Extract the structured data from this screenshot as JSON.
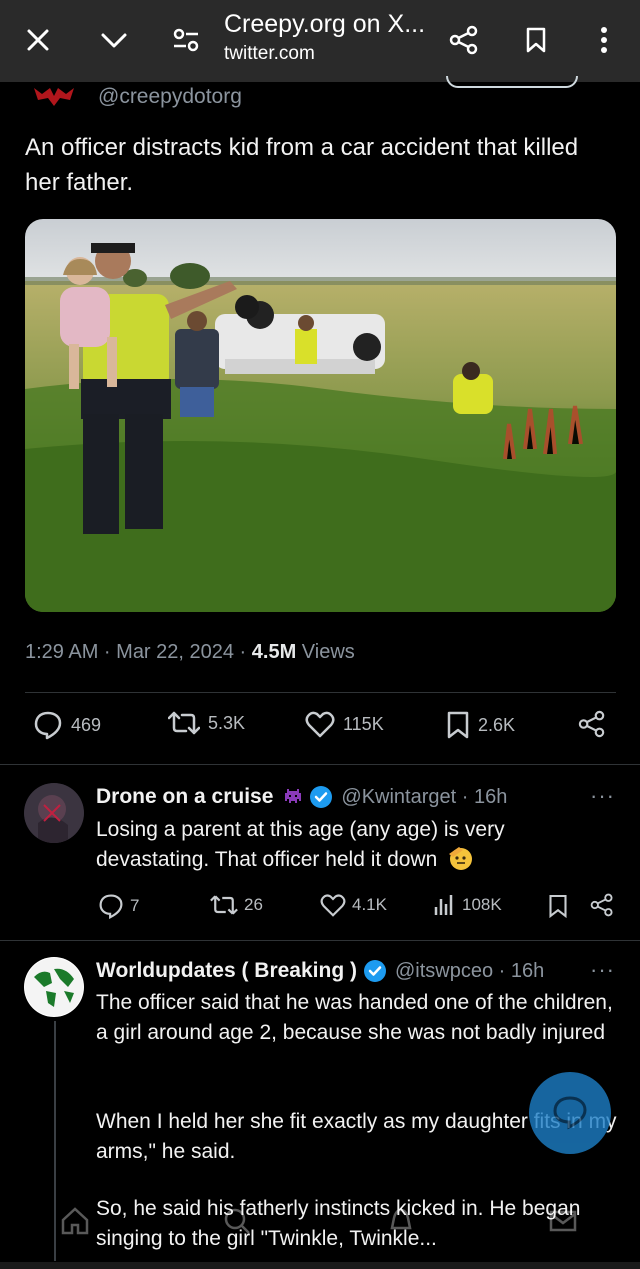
{
  "browser": {
    "title": "Creepy.org on X...",
    "url": "twitter.com"
  },
  "tweet": {
    "handle": "@creepydotorg",
    "text": "An officer distracts kid from a car accident that killed her father.",
    "time_date": "1:29 AM · Mar 22, 2024 · ",
    "views_count": "4.5M",
    "views_label": " Views",
    "replies": "469",
    "retweets": "5.3K",
    "likes": "115K",
    "bookmarks": "2.6K"
  },
  "replies": [
    {
      "name": "Drone on a cruise",
      "handle_time": "@Kwintarget · 16h",
      "text": "Losing a parent at this age (any age) is very devastating. That officer held it down",
      "replies": "7",
      "retweets": "26",
      "likes": "4.1K",
      "views": "108K"
    },
    {
      "name": "Worldupdates ( Breaking )",
      "handle_time": "@itswpceo · 16h",
      "p1": "The officer said that he was handed one of the children, a girl around age 2, because she was not badly injured",
      "p2": "When I held her she fit exactly as my daughter fits in my arms,\" he said.",
      "p3": "So, he said his fatherly instincts kicked in. He began singing to the girl \"Twinkle, Twinkle..."
    }
  ],
  "colors": {
    "verified": "#1d9bf0",
    "muted": "#8b949e",
    "background": "#000000",
    "browser_bar": "#2a2a2a"
  }
}
